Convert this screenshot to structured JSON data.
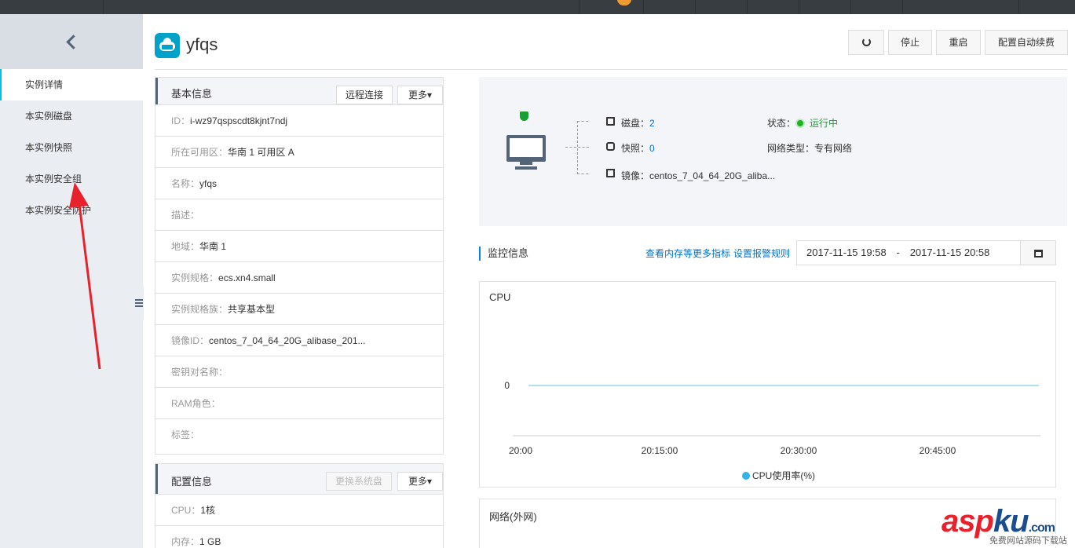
{
  "sidebar": {
    "back_icon": "chevron-left-icon",
    "items": [
      {
        "label": "实例详情",
        "active": true
      },
      {
        "label": "本实例磁盘"
      },
      {
        "label": "本实例快照"
      },
      {
        "label": "本实例安全组"
      },
      {
        "label": "本实例安全防护"
      }
    ]
  },
  "instance": {
    "name": "yfqs",
    "icon": "ecs-cloud-icon"
  },
  "toolbar": {
    "refresh_icon": "refresh-icon",
    "stop": "停止",
    "restart": "重启",
    "auto_renew": "配置自动续费"
  },
  "basic_info": {
    "title": "基本信息",
    "remote_btn": "远程连接",
    "more_btn": "更多",
    "rows": [
      {
        "label": "ID：",
        "value": "i-wz97qspscdt8kjnt7ndj"
      },
      {
        "label": "所在可用区：",
        "value": "华南 1 可用区 A"
      },
      {
        "label": "名称：",
        "value": "yfqs"
      },
      {
        "label": "描述：",
        "value": ""
      },
      {
        "label": "地域：",
        "value": "华南 1"
      },
      {
        "label": "实例规格：",
        "value": "ecs.xn4.small"
      },
      {
        "label": "实例规格族：",
        "value": "共享基本型"
      },
      {
        "label": "镜像ID：",
        "value": "centos_7_04_64_20G_alibase_201..."
      },
      {
        "label": "密钥对名称：",
        "value": ""
      },
      {
        "label": "RAM角色：",
        "value": ""
      },
      {
        "label": "标签：",
        "value": ""
      }
    ]
  },
  "config_info": {
    "title": "配置信息",
    "change_os_btn": "更换系统盘",
    "more_btn": "更多",
    "rows": [
      {
        "label": "CPU：",
        "value": "1核"
      },
      {
        "label": "内存：",
        "value": "1 GB"
      }
    ]
  },
  "summary": {
    "disk_label": "磁盘：",
    "disk_value": "2",
    "snapshot_label": "快照：",
    "snapshot_value": "0",
    "image_label": "镜像：",
    "image_value": "centos_7_04_64_20G_aliba...",
    "status_label": "状态：",
    "status_value": "运行中",
    "network_label": "网络类型：",
    "network_value": "专有网络",
    "status_color": "#1db41d"
  },
  "monitor": {
    "title": "监控信息",
    "link_more": "查看内存等更多指标",
    "link_alarm": "设置报警规则",
    "date_start": "2017-11-15 19:58",
    "date_sep": "-",
    "date_end": "2017-11-15 20:58",
    "calendar_icon": "calendar-icon"
  },
  "chart_data": [
    {
      "type": "line",
      "title": "CPU",
      "x": [
        "20:00",
        "20:15:00",
        "20:30:00",
        "20:45:00"
      ],
      "series": [
        {
          "name": "CPU使用率(%)",
          "values": [
            0,
            0,
            0,
            0
          ],
          "color": "#33b3e8"
        }
      ],
      "yticks": [
        "0"
      ],
      "grid": false,
      "legend": "bottom"
    },
    {
      "type": "line",
      "title": "网络(外网)"
    }
  ],
  "watermark": {
    "asp": "asp",
    "ku": "ku",
    "com": ".com",
    "sub": "免费网站源码下载站"
  },
  "annotation": {
    "color": "#e8222d"
  }
}
